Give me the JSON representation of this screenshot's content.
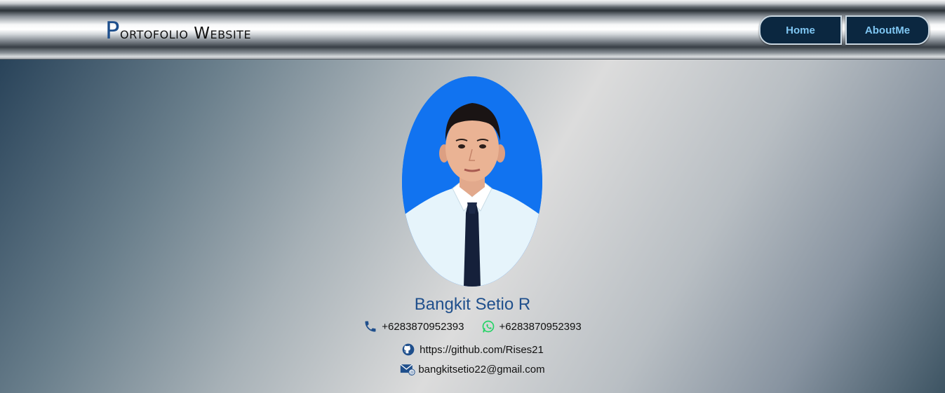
{
  "brand": {
    "initial": "P",
    "rest": "ortofolio Website"
  },
  "nav": [
    {
      "label": "Home"
    },
    {
      "label": "AboutMe"
    }
  ],
  "profile": {
    "name": "Bangkit Setio R",
    "phone": "+6283870952393",
    "whatsapp": "+6283870952393",
    "github": "https://github.com/Rises21",
    "email": "bangkitsetio22@gmail.com"
  },
  "icons": {
    "phone": "phone-icon",
    "whatsapp": "whatsapp-icon",
    "github": "github-icon",
    "email": "email-icon"
  },
  "colors": {
    "accent": "#1f4f8c",
    "nav_bg": "#0b2740",
    "nav_text": "#7fc6f2",
    "photo_bg": "#1173f0",
    "whatsapp": "#25d366"
  }
}
